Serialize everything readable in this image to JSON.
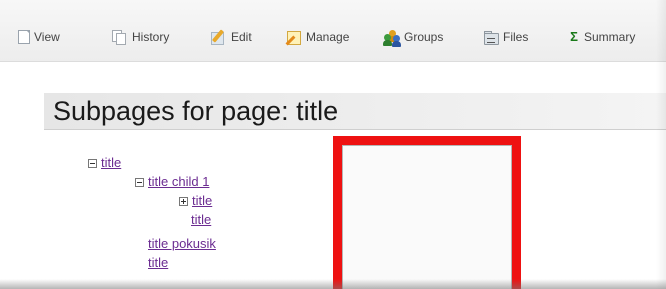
{
  "toolbar": {
    "items": [
      {
        "label": "View",
        "icon": "document-icon"
      },
      {
        "label": "History",
        "icon": "history-icon"
      },
      {
        "label": "Edit",
        "icon": "pencil-icon"
      },
      {
        "label": "Manage",
        "icon": "manage-icon"
      },
      {
        "label": "Groups",
        "icon": "groups-icon"
      },
      {
        "label": "Files",
        "icon": "files-icon"
      },
      {
        "label": "Summary",
        "icon": "sigma-icon",
        "symbol": "Σ"
      }
    ]
  },
  "heading": "Subpages for page: title",
  "tree": [
    {
      "label": "title",
      "toggle": "collapse"
    },
    {
      "label": "title child 1",
      "toggle": "collapse"
    },
    {
      "label": "title",
      "toggle": "expand"
    },
    {
      "label": "title"
    },
    {
      "label": "title pokusik"
    },
    {
      "label": "title"
    }
  ],
  "colors": {
    "link": "#6b2c91",
    "highlight": "#ee1111",
    "summary_icon": "#1a7a1a"
  }
}
